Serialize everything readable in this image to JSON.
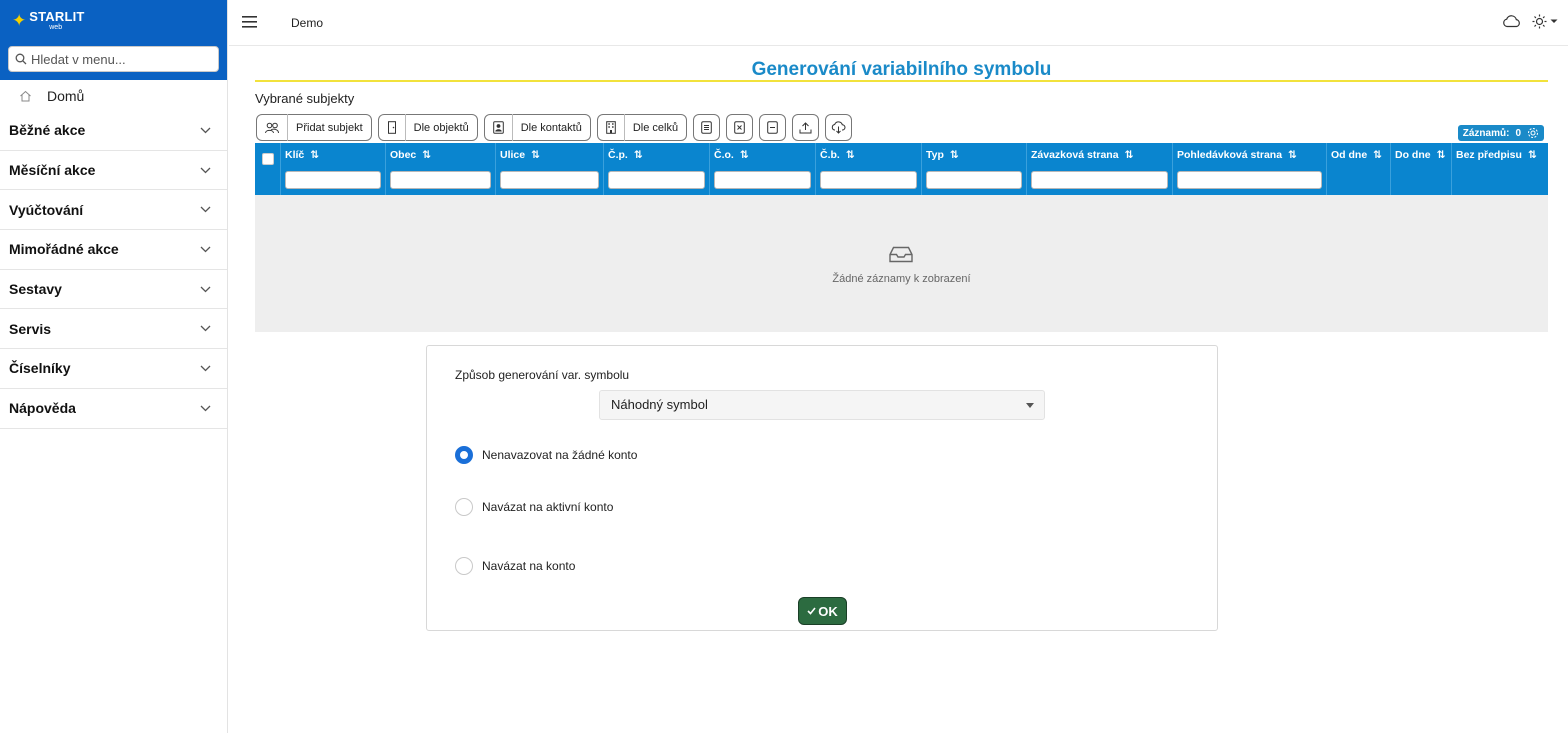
{
  "sidebar": {
    "brand": {
      "name": "STARLIT",
      "sub": "web"
    },
    "search_placeholder": "Hledat v menu...",
    "home_label": "Domů",
    "items": [
      {
        "label": "Běžné akce"
      },
      {
        "label": "Měsíční akce"
      },
      {
        "label": "Vyúčtování"
      },
      {
        "label": "Mimořádné akce"
      },
      {
        "label": "Sestavy"
      },
      {
        "label": "Servis"
      },
      {
        "label": "Číselníky"
      },
      {
        "label": "Nápověda"
      }
    ]
  },
  "topbar": {
    "context": "Demo"
  },
  "page": {
    "title": "Generování variabilního symbolu",
    "section_label": "Vybrané subjekty"
  },
  "toolbar": {
    "add_subject": "Přidat subjekt",
    "by_objects": "Dle objektů",
    "by_contacts": "Dle kontaktů",
    "by_units": "Dle celků"
  },
  "records": {
    "label": "Záznamů:",
    "count": "0"
  },
  "grid": {
    "columns": [
      {
        "label": "Klíč"
      },
      {
        "label": "Obec"
      },
      {
        "label": "Ulice"
      },
      {
        "label": "Č.p."
      },
      {
        "label": "Č.o."
      },
      {
        "label": "Č.b."
      },
      {
        "label": "Typ"
      },
      {
        "label": "Závazková strana"
      },
      {
        "label": "Pohledávková strana"
      },
      {
        "label": "Od dne"
      },
      {
        "label": "Do dne"
      },
      {
        "label": "Bez předpisu"
      }
    ],
    "empty_text": "Žádné záznamy k zobrazení"
  },
  "form": {
    "method_label": "Způsob generování var. symbolu",
    "method_value": "Náhodný symbol",
    "options": [
      {
        "label": "Nenavazovat na žádné konto",
        "checked": true
      },
      {
        "label": "Navázat na aktivní konto",
        "checked": false
      },
      {
        "label": "Navázat na konto",
        "checked": false
      }
    ],
    "ok_label": "OK"
  },
  "colors": {
    "brand_blue": "#0a61c2",
    "grid_header": "#0a85cf",
    "title": "#1a8ac8",
    "accent_underline": "#f2e23c",
    "ok_button": "#2c6b40"
  }
}
